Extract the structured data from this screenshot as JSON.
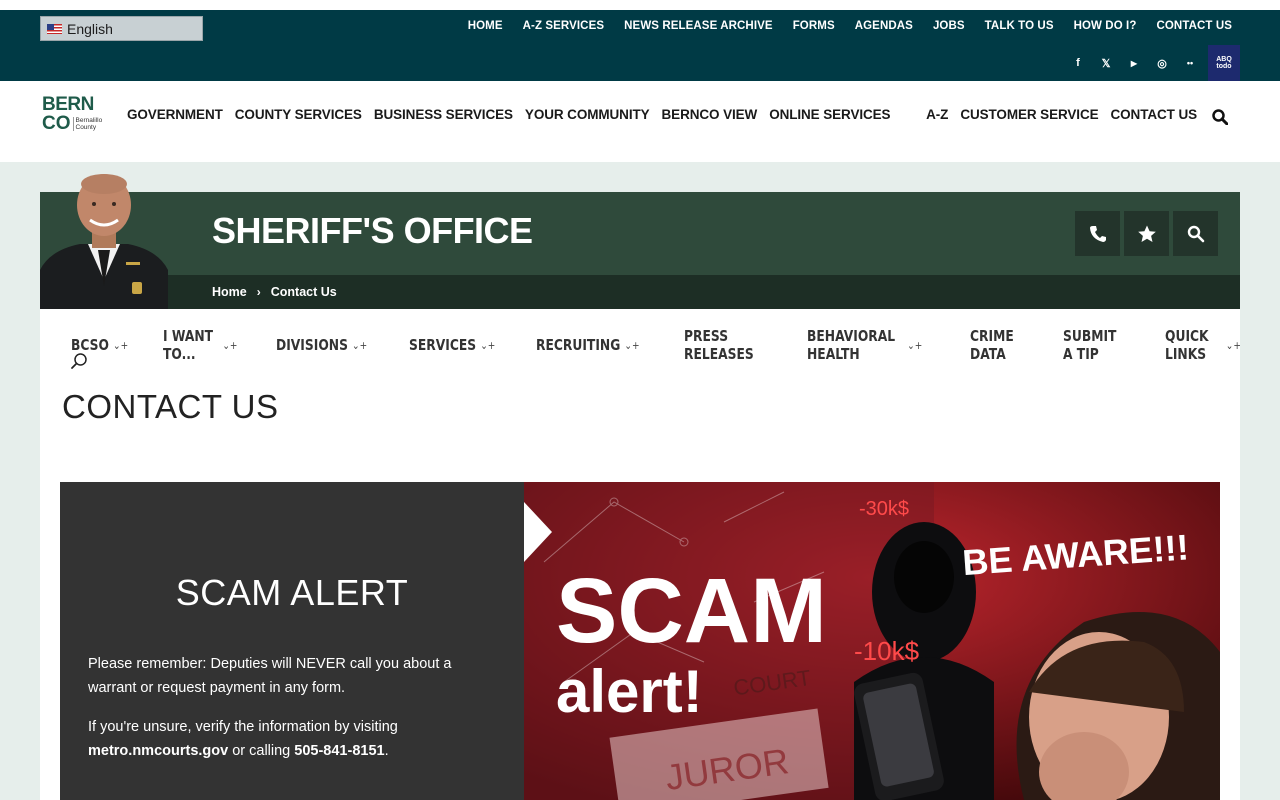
{
  "language": {
    "selected": "English"
  },
  "top_links": [
    "HOME",
    "A-Z SERVICES",
    "NEWS RELEASE ARCHIVE",
    "FORMS",
    "AGENDAS",
    "JOBS",
    "TALK TO US",
    "HOW DO I?",
    "CONTACT US"
  ],
  "social": {
    "facebook": "f",
    "x": "𝕏",
    "youtube": "▶",
    "instagram": "◎",
    "flickr": "••",
    "abq_badge": "ABQ todo"
  },
  "logo": {
    "line1": "BERN",
    "line2": "CO",
    "sub1": "Bernalillo",
    "sub2": "County"
  },
  "main_nav_left": [
    "GOVERNMENT",
    "COUNTY SERVICES",
    "BUSINESS SERVICES",
    "YOUR COMMUNITY",
    "BERNCO VIEW",
    "ONLINE SERVICES"
  ],
  "main_nav_right": [
    "A-Z",
    "CUSTOMER SERVICE",
    "CONTACT US"
  ],
  "banner": {
    "title": "SHERIFF'S OFFICE"
  },
  "breadcrumb": {
    "home": "Home",
    "sep": "›",
    "current": "Contact Us"
  },
  "sub_nav": [
    {
      "label": "BCSO",
      "dropdown": "⌄+"
    },
    {
      "label": "I WANT TO...",
      "dropdown": "⌄+"
    },
    {
      "label": "DIVISIONS",
      "dropdown": "⌄+"
    },
    {
      "label": "SERVICES",
      "dropdown": "⌄+"
    },
    {
      "label": "RECRUITING",
      "dropdown": "⌄+"
    },
    {
      "label": "PRESS RELEASES",
      "dropdown": ""
    },
    {
      "label": "BEHAVIORAL HEALTH",
      "dropdown": "⌄+"
    },
    {
      "label": "CRIME DATA",
      "dropdown": ""
    },
    {
      "label": "SUBMIT A TIP",
      "dropdown": ""
    },
    {
      "label": "QUICK LINKS",
      "dropdown": "⌄+"
    }
  ],
  "page_title": "CONTACT US",
  "scam": {
    "title": "SCAM ALERT",
    "p1": "Please remember: Deputies will NEVER call you about a warrant or request payment in any form.",
    "p2_pre": "If you're unsure, verify the information by visiting",
    "p2_link": "metro.nmcourts.gov",
    "p2_mid": " or calling ",
    "p2_phone": "505-841-8151",
    "p2_end": ".",
    "image": {
      "big1": "SCAM",
      "big2": "alert!",
      "aware": "BE AWARE!!!",
      "money1": "-30k$",
      "money2": "-10k$",
      "juror": "JUROR",
      "court": "COURT"
    }
  }
}
